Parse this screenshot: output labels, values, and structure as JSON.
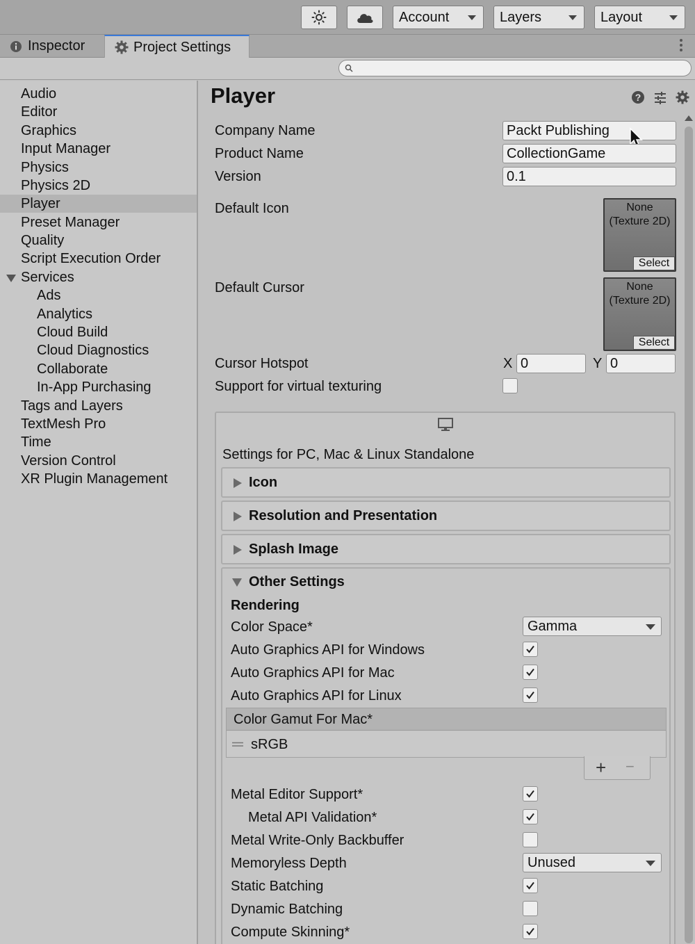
{
  "toolbar": {
    "account_label": "Account",
    "layers_label": "Layers",
    "layout_label": "Layout"
  },
  "tabs": [
    {
      "label": "Inspector"
    },
    {
      "label": "Project Settings"
    }
  ],
  "search": {
    "placeholder": "",
    "value": ""
  },
  "sidebar": {
    "items": [
      {
        "label": "Audio"
      },
      {
        "label": "Editor"
      },
      {
        "label": "Graphics"
      },
      {
        "label": "Input Manager"
      },
      {
        "label": "Physics"
      },
      {
        "label": "Physics 2D"
      },
      {
        "label": "Player"
      },
      {
        "label": "Preset Manager"
      },
      {
        "label": "Quality"
      },
      {
        "label": "Script Execution Order"
      },
      {
        "label": "Services"
      },
      {
        "label": "Ads"
      },
      {
        "label": "Analytics"
      },
      {
        "label": "Cloud Build"
      },
      {
        "label": "Cloud Diagnostics"
      },
      {
        "label": "Collaborate"
      },
      {
        "label": "In-App Purchasing"
      },
      {
        "label": "Tags and Layers"
      },
      {
        "label": "TextMesh Pro"
      },
      {
        "label": "Time"
      },
      {
        "label": "Version Control"
      },
      {
        "label": "XR Plugin Management"
      }
    ],
    "selected": "Player"
  },
  "player": {
    "title": "Player",
    "company_label": "Company Name",
    "company_value": "Packt Publishing",
    "product_label": "Product Name",
    "product_value": "CollectionGame",
    "version_label": "Version",
    "version_value": "0.1",
    "default_icon_label": "Default Icon",
    "default_cursor_label": "Default Cursor",
    "object_none": "None",
    "object_type": "(Texture 2D)",
    "select_label": "Select",
    "hotspot_label": "Cursor Hotspot",
    "hotspot_x_label": "X",
    "hotspot_x": "0",
    "hotspot_y_label": "Y",
    "hotspot_y": "0",
    "virtual_texturing_label": "Support for virtual texturing",
    "virtual_texturing": false
  },
  "platform": {
    "title": "Settings for PC, Mac & Linux Standalone",
    "sections": [
      "Icon",
      "Resolution and Presentation",
      "Splash Image"
    ],
    "other_settings_label": "Other Settings",
    "rendering_label": "Rendering",
    "color_space_label": "Color Space*",
    "color_space_value": "Gamma",
    "auto_gfx_windows_label": "Auto Graphics API  for Windows",
    "auto_gfx_windows": true,
    "auto_gfx_mac_label": "Auto Graphics API  for Mac",
    "auto_gfx_mac": true,
    "auto_gfx_linux_label": "Auto Graphics API  for Linux",
    "auto_gfx_linux": true,
    "color_gamut_label": "Color Gamut For Mac*",
    "color_gamut_item": "sRGB",
    "add_symbol": "+",
    "remove_symbol": "−",
    "metal_editor_label": "Metal Editor Support*",
    "metal_editor": true,
    "metal_api_validation_label": "Metal API Validation*",
    "metal_api_validation": true,
    "metal_write_only_label": "Metal Write-Only Backbuffer",
    "metal_write_only": false,
    "memoryless_label": "Memoryless Depth",
    "memoryless_value": "Unused",
    "static_batching_label": "Static Batching",
    "static_batching": true,
    "dynamic_batching_label": "Dynamic Batching",
    "dynamic_batching": false,
    "compute_skinning_label": "Compute Skinning*",
    "compute_skinning": true
  },
  "icons": [
    "sun-icon",
    "cloud-icon",
    "info-icon",
    "gear-icon",
    "search-icon",
    "help-icon",
    "sliders-icon",
    "monitor-icon",
    "drag-handle-icon",
    "mouse-cursor-icon",
    "checkmark-icon"
  ]
}
